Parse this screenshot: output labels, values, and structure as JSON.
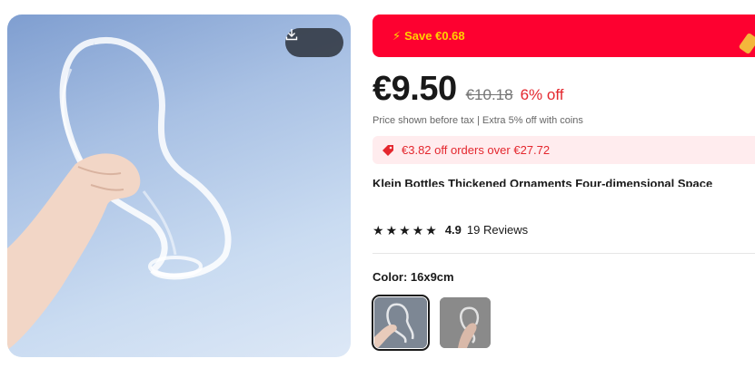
{
  "product": {
    "save_label": "Save €0.68",
    "price_current": "€9.50",
    "price_original": "€10.18",
    "price_discount": "6% off",
    "tax_note": "Price shown before tax | Extra 5% off with coins",
    "coupon_text": "€3.82 off orders over €27.72",
    "title": "Klein Bottles Thickened Ornaments Four-dimensional Space",
    "rating": "4.9",
    "reviews": "19 Reviews",
    "color_label": "Color: 16x9cm",
    "stars": 5
  },
  "colors": {
    "banner": "#fd0130",
    "banner_text": "#ffd100",
    "discount": "#e4272e"
  },
  "icons": {
    "download": "download-icon",
    "bolt": "lightning-icon",
    "coupon": "tag-icon",
    "star": "star-icon"
  }
}
